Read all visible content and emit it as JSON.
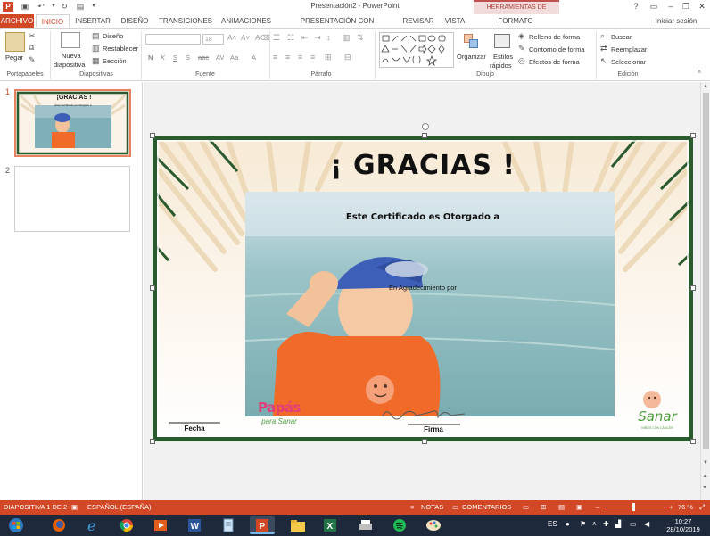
{
  "window": {
    "title": "Presentación2 - PowerPoint"
  },
  "context_header": "HERRAMIENTAS DE IMAGEN",
  "tabs": [
    {
      "label": "ARCHIVO"
    },
    {
      "label": "INICIO"
    },
    {
      "label": "INSERTAR"
    },
    {
      "label": "DISEÑO"
    },
    {
      "label": "TRANSICIONES"
    },
    {
      "label": "ANIMACIONES"
    },
    {
      "label": "PRESENTACIÓN CON DIAPOSITIVAS"
    },
    {
      "label": "REVISAR"
    },
    {
      "label": "VISTA"
    },
    {
      "label": "FORMATO"
    }
  ],
  "account": {
    "signin": "Iniciar sesión"
  },
  "ribbon": {
    "portapapeles": {
      "label": "Portapapeles",
      "paste": "Pegar"
    },
    "diapositivas": {
      "label": "Diapositivas",
      "new_slide_line1": "Nueva",
      "new_slide_line2": "diapositiva",
      "layout": "Diseño",
      "reset": "Restablecer",
      "section": "Sección"
    },
    "fuente": {
      "label": "Fuente",
      "font_size": "18",
      "bold": "N",
      "italic": "K",
      "underline": "S",
      "strike": "S",
      "shadow": "abc",
      "spacing": "AV",
      "case": "Aa",
      "color": "A"
    },
    "parrafo": {
      "label": "Párrafo"
    },
    "dibujo": {
      "label": "Dibujo",
      "arrange": "Organizar",
      "styles_line1": "Estilos",
      "styles_line2": "rápidos",
      "fill": "Relleno de forma",
      "outline": "Contorno de forma",
      "effects": "Efectos de forma"
    },
    "edicion": {
      "label": "Edición",
      "find": "Buscar",
      "replace": "Reemplazar",
      "select": "Seleccionar"
    }
  },
  "thumbnails": [
    {
      "number": "1",
      "title": "¡GRACIAS !",
      "subtitle": "Este Certificado es Otorgado a"
    },
    {
      "number": "2"
    }
  ],
  "slide": {
    "title": "¡ GRACIAS !",
    "certificate_text": "Este Certificado es Otorgado a",
    "thanks_text": "En Agradecimiento por",
    "date_label": "Fecha",
    "signature_label": "Firma",
    "logo_left_line1": "Papás",
    "logo_left_line2": "para Sanar",
    "logo_right_name": "Sanar",
    "logo_right_tagline": "NIÑOS CON CÁNCER"
  },
  "status": {
    "slide_info": "DIAPOSITIVA 1 DE 2",
    "language": "ESPAÑOL (ESPAÑA)",
    "notes": "NOTAS",
    "comments": "COMENTARIOS",
    "zoom": "76 %"
  },
  "taskbar": {
    "lang": "ES",
    "time": "10:27",
    "date": "28/10/2019"
  },
  "colors": {
    "accent": "#d24726",
    "slide_frame": "#2b5a2e",
    "shirt": "#f06a2a",
    "cap": "#3d5fb8"
  }
}
